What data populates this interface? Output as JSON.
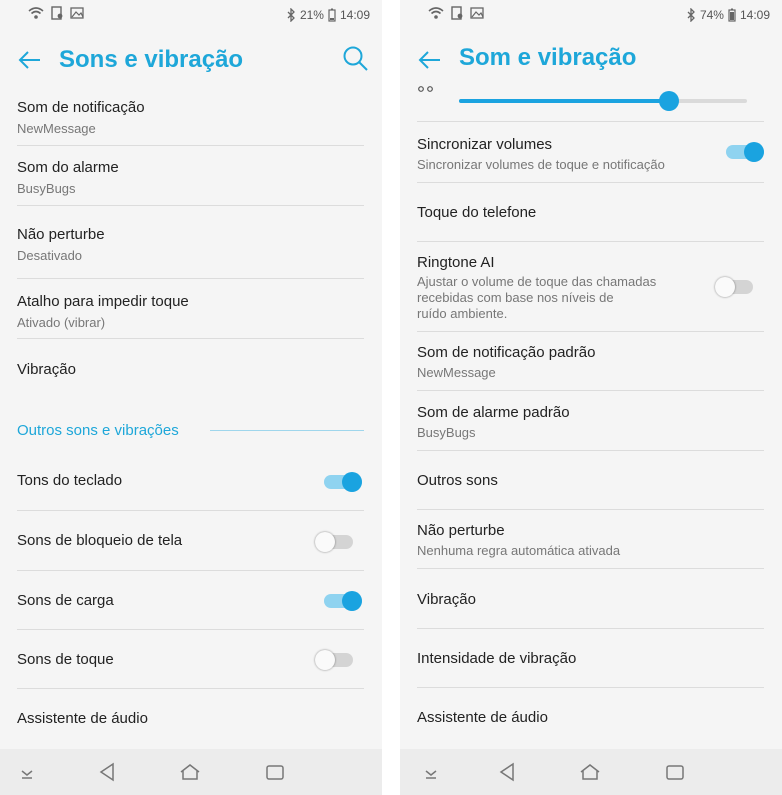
{
  "colors": {
    "accent": "#1ea7d9",
    "toggle_on": "#1aa3e0",
    "toggle_off": "#d4d4d4"
  },
  "left": {
    "status": {
      "battery": "21%",
      "time": "14:09"
    },
    "title": "Sons e vibração",
    "items": [
      {
        "label": "Som de notificação",
        "sub": "NewMessage"
      },
      {
        "label": "Som do alarme",
        "sub": "BusyBugs"
      },
      {
        "label": "Não perturbe",
        "sub": "Desativado"
      },
      {
        "label": "Atalho para impedir toque",
        "sub": "Ativado (vibrar)"
      },
      {
        "label": "Vibração"
      }
    ],
    "section_title": "Outros sons e vibrações",
    "toggles": [
      {
        "label": "Tons do teclado",
        "on": true
      },
      {
        "label": "Sons de bloqueio de tela",
        "on": false
      },
      {
        "label": "Sons de carga",
        "on": true
      },
      {
        "label": "Sons de toque",
        "on": false
      }
    ],
    "last_item": {
      "label": "Assistente de áudio"
    }
  },
  "right": {
    "status": {
      "battery": "74%",
      "time": "14:09"
    },
    "title": "Som e vibração",
    "slider_level": 0.73,
    "items": [
      {
        "label": "Sincronizar volumes",
        "sub": "Sincronizar volumes de toque e notificação",
        "toggle": true
      },
      {
        "label": "Toque do telefone"
      },
      {
        "label": "Ringtone AI",
        "sub_lines": [
          "Ajustar o volume de toque das chamadas",
          "recebidas com base nos níveis de",
          "ruído ambiente."
        ],
        "toggle": false
      },
      {
        "label": "Som de notificação padrão",
        "sub": "NewMessage"
      },
      {
        "label": "Som de alarme padrão",
        "sub": "BusyBugs"
      },
      {
        "label": "Outros sons"
      },
      {
        "label": "Não perturbe",
        "sub": "Nenhuma regra automática ativada"
      },
      {
        "label": "Vibração"
      },
      {
        "label": "Intensidade de vibração"
      },
      {
        "label": "Assistente de áudio"
      }
    ]
  },
  "nav_icons": [
    "collapse-icon",
    "back-triangle-icon",
    "home-icon",
    "recents-icon"
  ]
}
